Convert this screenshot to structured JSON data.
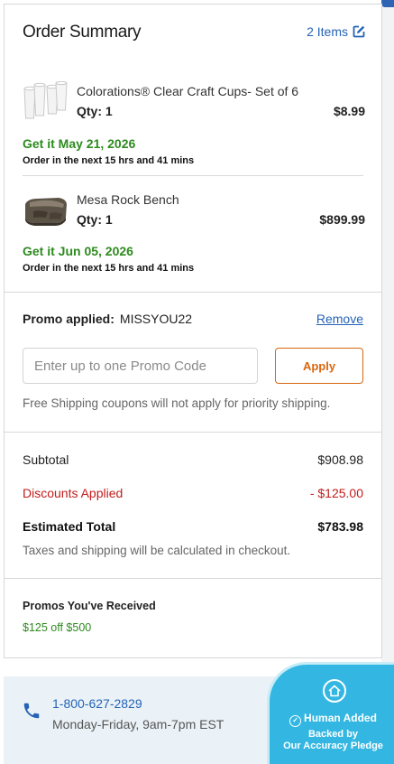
{
  "header": {
    "title": "Order Summary",
    "items_link": "2 Items"
  },
  "items": [
    {
      "name": "Colorations® Clear Craft Cups- Set of 6",
      "qty": "Qty: 1",
      "price": "$8.99",
      "eta": "Get it May 21, 2026",
      "cutoff": "Order in the next 15 hrs and 41 mins",
      "thumb_icon": "clear-cups-image"
    },
    {
      "name": "Mesa Rock Bench",
      "qty": "Qty: 1",
      "price": "$899.99",
      "eta": "Get it Jun 05, 2026",
      "cutoff": "Order in the next 15 hrs and 41 mins",
      "thumb_icon": "rock-bench-image"
    }
  ],
  "promo": {
    "applied_label": "Promo applied:",
    "applied_code": "MISSYOU22",
    "remove_label": "Remove",
    "input_placeholder": "Enter up to one Promo Code",
    "input_value": "",
    "apply_label": "Apply",
    "note": "Free Shipping coupons will not apply for priority shipping."
  },
  "totals": {
    "subtotal_label": "Subtotal",
    "subtotal_value": "$908.98",
    "discount_label": "Discounts Applied",
    "discount_value": "- $125.00",
    "estimated_label": "Estimated Total",
    "estimated_value": "$783.98",
    "tax_note": "Taxes and shipping will be calculated in checkout."
  },
  "received": {
    "title": "Promos You've Received",
    "items": [
      "$125 off $500"
    ]
  },
  "contact": {
    "phone": "1-800-627-2829",
    "hours": "Monday-Friday, 9am-7pm EST"
  },
  "badge": {
    "title": "Human Added",
    "subtitle_line1": "Backed by",
    "subtitle_line2": "Our Accuracy Pledge"
  },
  "colors": {
    "link": "#2563b5",
    "eta_green": "#2e8a1f",
    "discount_red": "#c21c1c",
    "apply_orange": "#d9670f",
    "badge_blue": "#33b7e2"
  }
}
